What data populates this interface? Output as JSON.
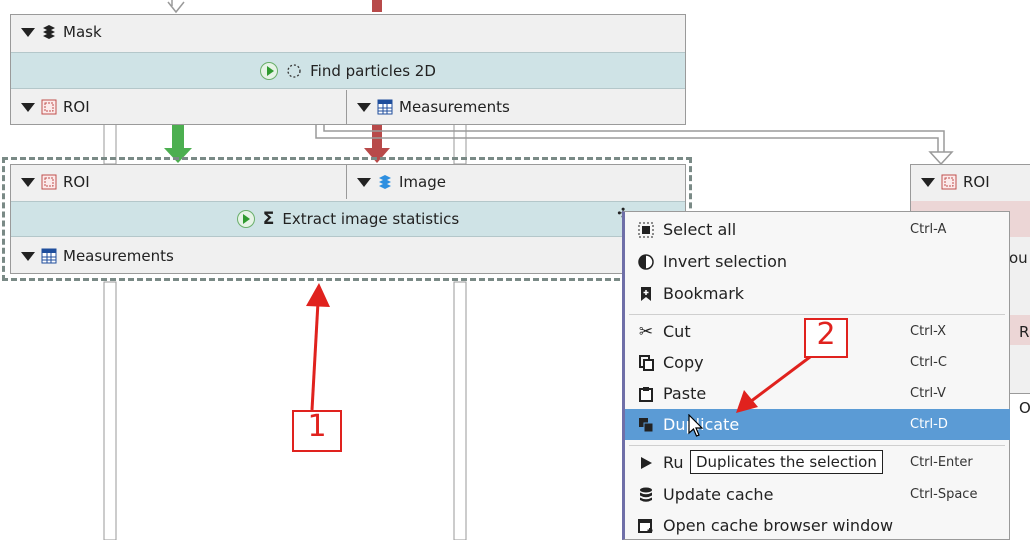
{
  "top_node": {
    "header_label": "Mask",
    "algorithm_label": "Find particles 2D",
    "outputs": [
      {
        "label": "ROI",
        "icon": "roi-icon"
      },
      {
        "label": "Measurements",
        "icon": "table-icon"
      }
    ]
  },
  "selected_node": {
    "inputs": [
      {
        "label": "ROI",
        "icon": "roi-icon"
      },
      {
        "label": "Image",
        "icon": "layers-icon"
      }
    ],
    "algorithm_label": "Extract image statistics",
    "outputs": [
      {
        "label": "Measurements",
        "icon": "table-icon"
      }
    ]
  },
  "right_node": {
    "input_label": "ROI",
    "partial_texts": [
      "ou",
      "R",
      "O"
    ]
  },
  "context_menu": {
    "items": [
      {
        "label": "Select all",
        "shortcut": "Ctrl-A",
        "icon": "select-all-icon"
      },
      {
        "label": "Invert selection",
        "shortcut": "",
        "icon": "invert-selection-icon"
      },
      {
        "label": "Bookmark",
        "shortcut": "",
        "icon": "bookmark-icon"
      },
      {
        "label": "Cut",
        "shortcut": "Ctrl-X",
        "icon": "scissors-icon"
      },
      {
        "label": "Copy",
        "shortcut": "Ctrl-C",
        "icon": "copy-icon"
      },
      {
        "label": "Paste",
        "shortcut": "Ctrl-V",
        "icon": "paste-icon"
      },
      {
        "label": "Duplicate",
        "shortcut": "Ctrl-D",
        "icon": "duplicate-icon",
        "selected": true
      },
      {
        "label": "Ru",
        "shortcut": "Ctrl-Enter",
        "icon": "run-icon"
      },
      {
        "label": "Update cache",
        "shortcut": "Ctrl-Space",
        "icon": "database-icon"
      },
      {
        "label": "Open cache browser window",
        "shortcut": "",
        "icon": "cache-window-icon"
      }
    ]
  },
  "tooltip": "Duplicates the selection",
  "annotations": {
    "label_1": "1",
    "label_2": "2",
    "color": "#e0221e"
  },
  "colors": {
    "algorithm_band": "#cfe3e6",
    "selection_highlight": "#5b9bd5",
    "green_arrow": "#4caf50",
    "red_arrow": "#b84a4a"
  }
}
